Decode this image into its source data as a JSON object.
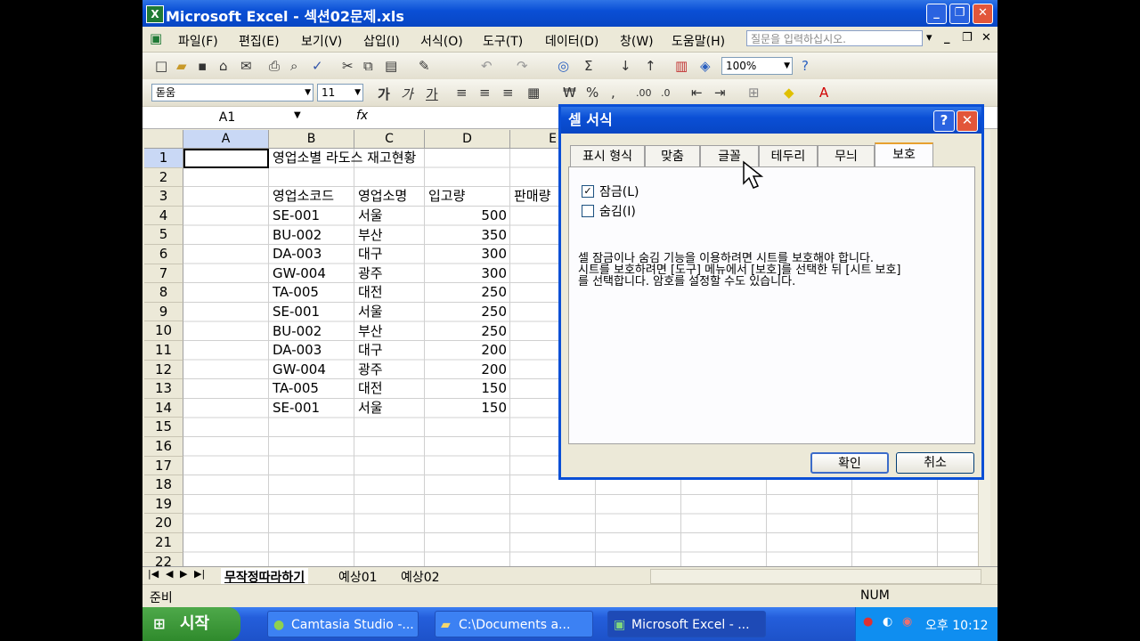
{
  "window": {
    "title": "Microsoft Excel - 섹션02문제.xls",
    "icon": "excel-icon"
  },
  "menu": {
    "items": [
      "파일(F)",
      "편집(E)",
      "보기(V)",
      "삽입(I)",
      "서식(O)",
      "도구(T)",
      "데이터(D)",
      "창(W)",
      "도움말(H)"
    ],
    "help_placeholder": "질문을 입력하십시오."
  },
  "toolbar": {
    "zoom": "100%",
    "font": "돋움",
    "font_size": "11",
    "bold": "가",
    "italic": "가",
    "underline": "가",
    "currency": "₩",
    "percent": "%",
    "comma": ","
  },
  "formula_bar": {
    "name_box": "A1",
    "fx": "fx",
    "value": ""
  },
  "sheet": {
    "columns": [
      "A",
      "B",
      "C",
      "D",
      "E"
    ],
    "rows": [
      "1",
      "2",
      "3",
      "4",
      "5",
      "6",
      "7",
      "8",
      "9",
      "10",
      "11",
      "12",
      "13",
      "14",
      "15",
      "16",
      "17",
      "18",
      "19",
      "20",
      "21",
      "22"
    ],
    "b1_title": "영업소별 라도스 재고현황",
    "headers": [
      "영업소코드",
      "영업소명",
      "입고량",
      "판매량"
    ],
    "data": [
      [
        "SE-001",
        "서울",
        "500"
      ],
      [
        "BU-002",
        "부산",
        "350"
      ],
      [
        "DA-003",
        "대구",
        "300"
      ],
      [
        "GW-004",
        "광주",
        "300"
      ],
      [
        "TA-005",
        "대전",
        "250"
      ],
      [
        "SE-001",
        "서울",
        "250"
      ],
      [
        "BU-002",
        "부산",
        "250"
      ],
      [
        "DA-003",
        "대구",
        "200"
      ],
      [
        "GW-004",
        "광주",
        "200"
      ],
      [
        "TA-005",
        "대전",
        "150"
      ],
      [
        "SE-001",
        "서울",
        "150"
      ]
    ]
  },
  "sheet_tabs": [
    "무작정따라하기",
    "예상01",
    "예상02"
  ],
  "status": {
    "left": "준비",
    "num": "NUM"
  },
  "dialog": {
    "title": "셀 서식",
    "tabs": [
      "표시 형식",
      "맞춤",
      "글꼴",
      "테두리",
      "무늬",
      "보호"
    ],
    "active_tab": "보호",
    "lock_label": "잠금(L)",
    "hide_label": "숨김(I)",
    "lock_checked": true,
    "hide_checked": false,
    "description_line1": "셀 잠금이나 숨김 기능을 이용하려면 시트를 보호해야 합니다.",
    "description_line2": "시트를 보호하려면 [도구] 메뉴에서 [보호]를 선택한 뒤 [시트 보호]",
    "description_line3": "를 선택합니다. 암호를 설정할 수도 있습니다.",
    "ok": "확인",
    "cancel": "취소"
  },
  "taskbar": {
    "start": "시작",
    "tasks": [
      "Camtasia Studio -...",
      "C:\\Documents a...",
      "Microsoft Excel - ..."
    ],
    "clock": "오후 10:12"
  }
}
